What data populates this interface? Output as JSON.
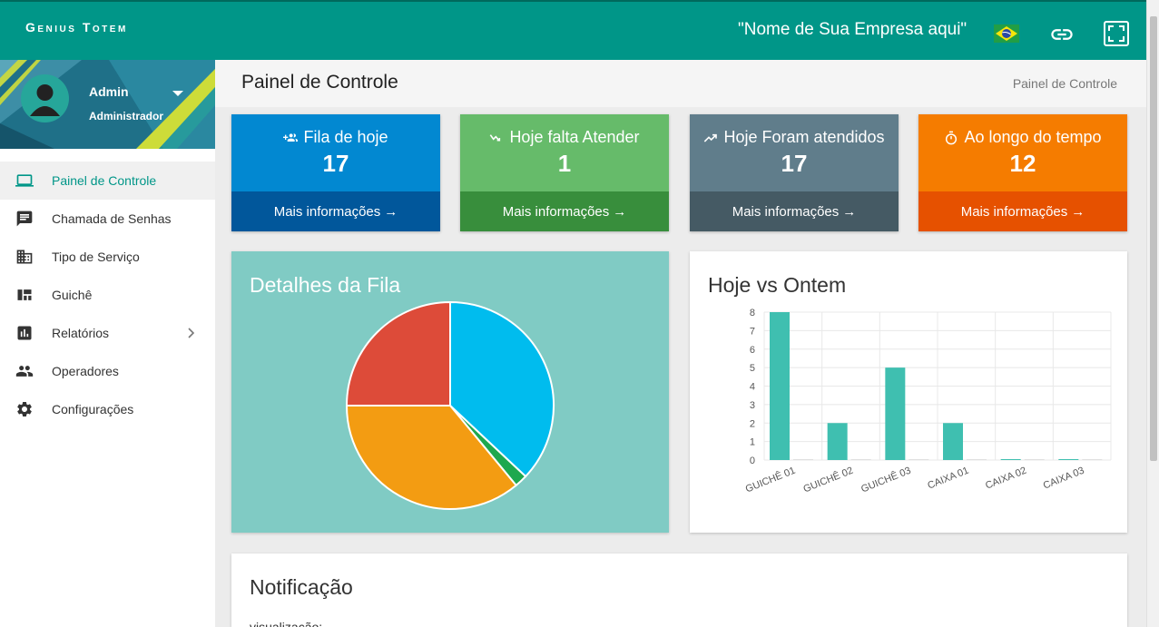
{
  "app": {
    "brand": "Genius Totem",
    "company": "\"Nome de Sua Empresa aqui\""
  },
  "profile": {
    "name": "Admin",
    "role": "Administrador"
  },
  "menu": [
    {
      "label": "Painel de Controle",
      "icon": "laptop-icon",
      "active": true
    },
    {
      "label": "Chamada de Senhas",
      "icon": "chat-icon"
    },
    {
      "label": "Tipo de Serviço",
      "icon": "building-icon"
    },
    {
      "label": "Guichê",
      "icon": "dashboard-icon"
    },
    {
      "label": "Relatórios",
      "icon": "bar-chart-icon",
      "has_submenu": true
    },
    {
      "label": "Operadores",
      "icon": "people-icon"
    },
    {
      "label": "Configurações",
      "icon": "gear-icon"
    }
  ],
  "header": {
    "title": "Painel de Controle",
    "breadcrumb": "Painel de Controle"
  },
  "stats": [
    {
      "label": "Fila de hoje",
      "value": "17",
      "more": "Mais informações",
      "icon": "group-add-icon",
      "color": "#0288d1",
      "footer": "#01579b"
    },
    {
      "label": "Hoje falta Atender",
      "value": "1",
      "more": "Mais informações",
      "icon": "trend-down-icon",
      "color": "#66bb6a",
      "footer": "#388e3c"
    },
    {
      "label": "Hoje Foram atendidos",
      "value": "17",
      "more": "Mais informações",
      "icon": "trend-up-icon",
      "color": "#607d8b",
      "footer": "#455a64"
    },
    {
      "label": "Ao longo do tempo",
      "value": "12",
      "more": "Mais informações",
      "icon": "timer-icon",
      "color": "#f57c00",
      "footer": "#e65100"
    }
  ],
  "queue_card": {
    "title": "Detalhes da Fila",
    "background": "#80cbc4"
  },
  "compare_card": {
    "title": "Hoje vs Ontem"
  },
  "notification_card": {
    "title": "Notificação",
    "text": "visualização:"
  },
  "chart_data": [
    {
      "type": "pie",
      "title": "Detalhes da Fila",
      "slices": [
        {
          "value": 37,
          "color": "#00bcee"
        },
        {
          "value": 2,
          "color": "#1ea84f"
        },
        {
          "value": 36,
          "color": "#f39c12"
        },
        {
          "value": 25,
          "color": "#dd4b39"
        }
      ]
    },
    {
      "type": "bar",
      "title": "Hoje vs Ontem",
      "categories": [
        "GUICHÊ 01",
        "GUICHÊ 02",
        "GUICHÊ 03",
        "CAIXA 01",
        "CAIXA 02",
        "CAIXA 03"
      ],
      "series": [
        {
          "values": [
            8,
            2,
            5,
            2,
            0,
            0
          ],
          "color": "#3fbfb0"
        },
        {
          "values": [
            0,
            0,
            0,
            0,
            0,
            0
          ],
          "color": "#e0e0e0"
        }
      ],
      "yticks": [
        "0",
        "1",
        "2",
        "3",
        "4",
        "5",
        "6",
        "7",
        "8"
      ],
      "ylim": [
        0,
        8
      ],
      "grid": true
    }
  ]
}
